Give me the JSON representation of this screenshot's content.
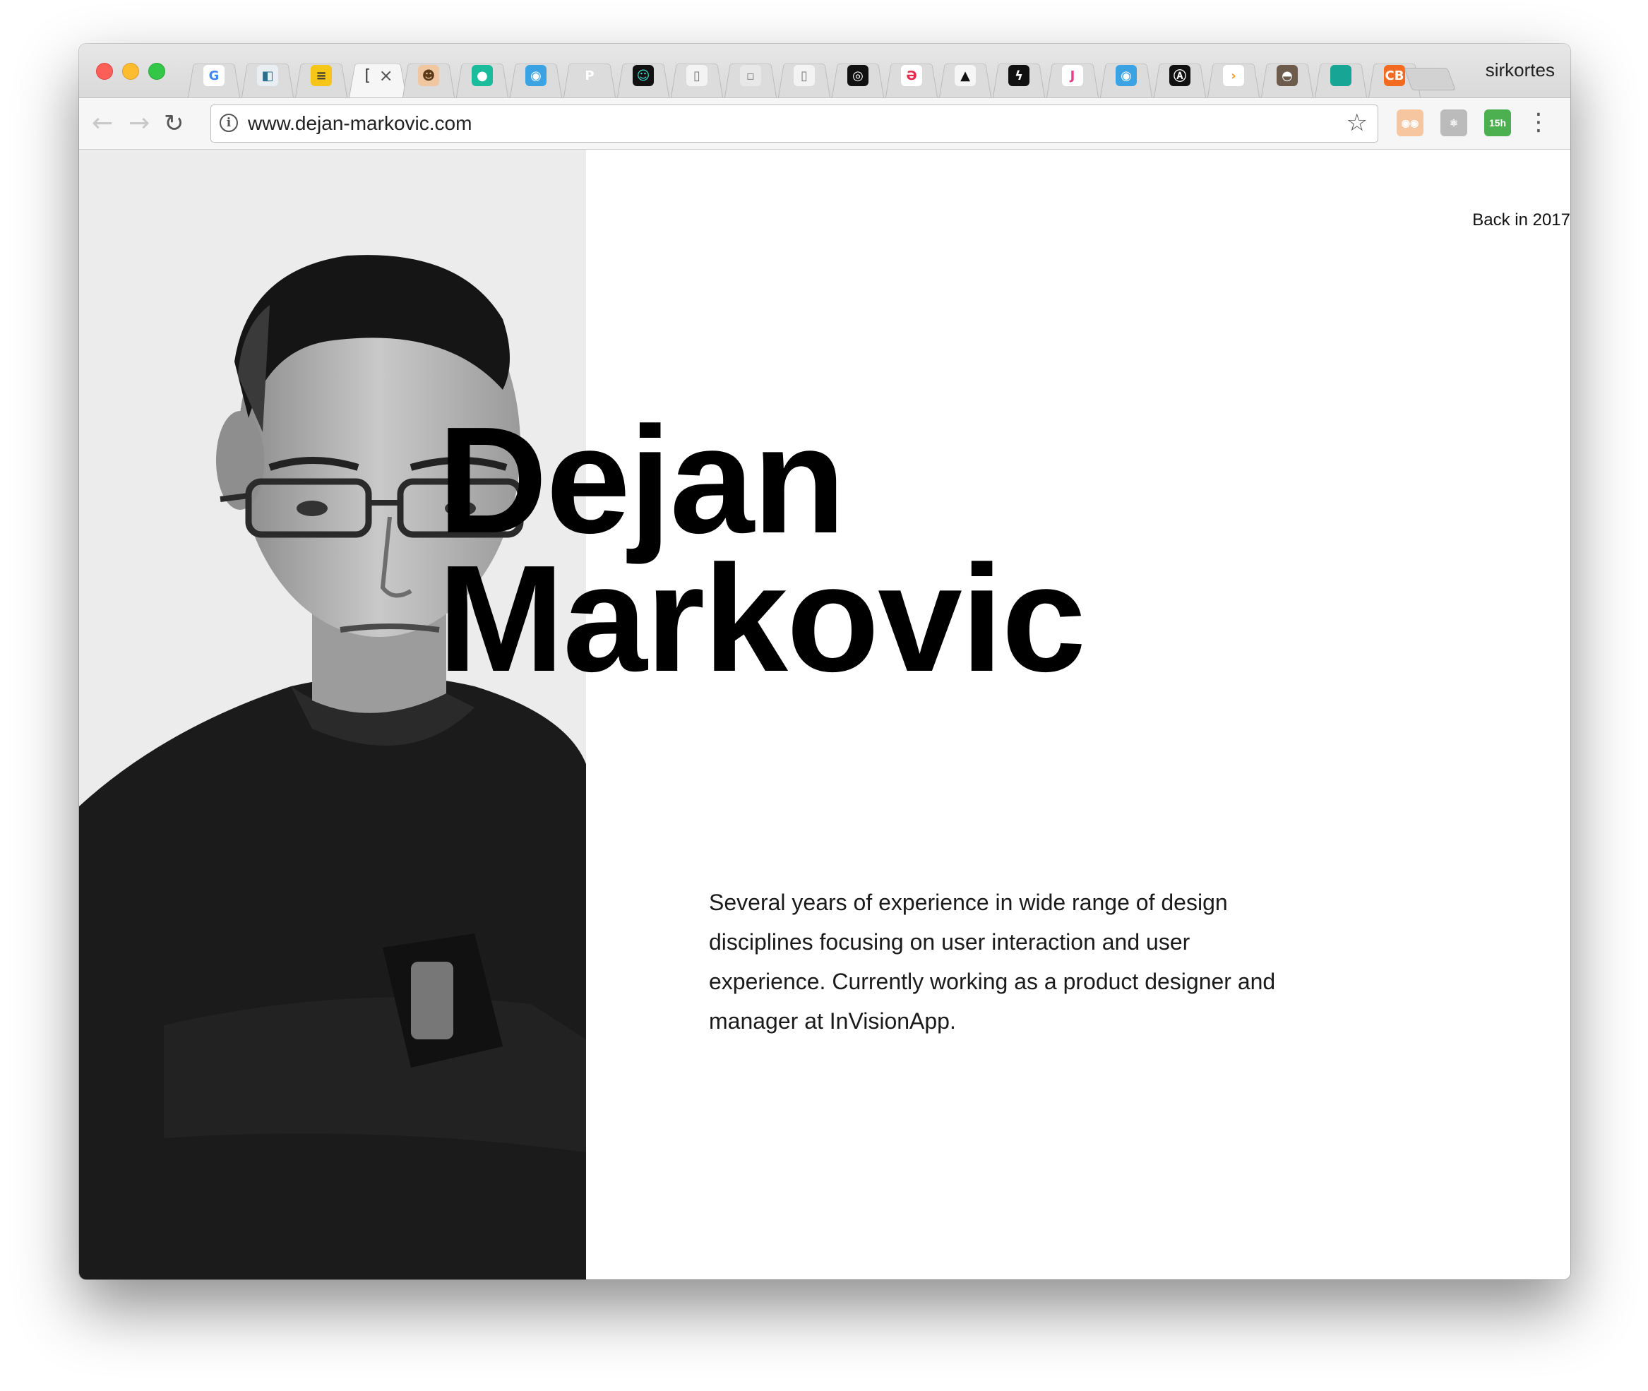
{
  "browser": {
    "profile_name": "sirkortes",
    "active_tab_label": "[",
    "tab_close": "×",
    "url": "www.dejan-markovic.com",
    "tab_favicons": [
      {
        "name": "google-favicon",
        "glyph": "G",
        "bg": "#ffffff",
        "fg": "#4285f4"
      },
      {
        "name": "doc-favicon",
        "glyph": "◧",
        "bg": "#e8eef2",
        "fg": "#2c6e8f"
      },
      {
        "name": "yellow-favicon",
        "glyph": "≡",
        "bg": "#f5c518",
        "fg": "#333333"
      },
      {
        "name": "avatar-favicon",
        "glyph": "☻",
        "bg": "#f0c7a0",
        "fg": "#5b3a1a"
      },
      {
        "name": "teal-favicon",
        "glyph": "●",
        "bg": "#1abc9c",
        "fg": "#ffffff"
      },
      {
        "name": "chart-favicon",
        "glyph": "◉",
        "bg": "#3ba3e4",
        "fg": "#ffffff"
      },
      {
        "name": "blank-favicon",
        "glyph": "P",
        "bg": "#dcdcdc",
        "fg": "#ffffff"
      },
      {
        "name": "alien-favicon",
        "glyph": "☺",
        "bg": "#111111",
        "fg": "#3fe0d0"
      },
      {
        "name": "page-favicon",
        "glyph": "▯",
        "bg": "#f3f3f3",
        "fg": "#777777"
      },
      {
        "name": "ba-favicon",
        "glyph": "▫",
        "bg": "#e8e8e8",
        "fg": "#888888"
      },
      {
        "name": "page2-favicon",
        "glyph": "▯",
        "bg": "#f3f3f3",
        "fg": "#777777"
      },
      {
        "name": "sdb-favicon",
        "glyph": "◎",
        "bg": "#111111",
        "fg": "#ffffff"
      },
      {
        "name": "red-spiral-favicon",
        "glyph": "Ә",
        "bg": "#ffffff",
        "fg": "#e8274b"
      },
      {
        "name": "triangle-favicon",
        "glyph": "▲",
        "bg": "#f6f6f6",
        "fg": "#111111"
      },
      {
        "name": "bolt-favicon",
        "glyph": "ϟ",
        "bg": "#111111",
        "fg": "#ffffff"
      },
      {
        "name": "j-favicon",
        "glyph": "J",
        "bg": "#ffffff",
        "fg": "#e83e8c"
      },
      {
        "name": "chart2-favicon",
        "glyph": "◉",
        "bg": "#3ba3e4",
        "fg": "#ffffff"
      },
      {
        "name": "ap-favicon",
        "glyph": "Ⓐ",
        "bg": "#111111",
        "fg": "#ffffff"
      },
      {
        "name": "chevron-favicon",
        "glyph": "›",
        "bg": "#ffffff",
        "fg": "#f39c12"
      },
      {
        "name": "coffee-favicon",
        "glyph": "◓",
        "bg": "#6d5b4c",
        "fg": "#ffffff"
      },
      {
        "name": "teal-square-favicon",
        "glyph": "",
        "bg": "#17a596",
        "fg": "#ffffff"
      },
      {
        "name": "cb-favicon",
        "glyph": "CB",
        "bg": "#f26b21",
        "fg": "#ffffff"
      }
    ],
    "extensions": [
      {
        "name": "owl-extension-icon",
        "label": "◉◉",
        "bg": "#f5c6a0"
      },
      {
        "name": "react-extension-icon",
        "label": "⚛",
        "bg": "#bbbbbb"
      },
      {
        "name": "calendar-extension-icon",
        "label": "15h",
        "bg": "#4caf50"
      }
    ]
  },
  "page": {
    "back_link": "Back in 2017",
    "name_line1": "Dejan",
    "name_line2": "Markovic",
    "bio": "Several years of experience in wide range of design disciplines focusing on user interaction and user experience. Currently working as a product designer and manager at InVisionApp."
  },
  "colors": {
    "photo_bg": "#ececec",
    "text": "#000000"
  }
}
